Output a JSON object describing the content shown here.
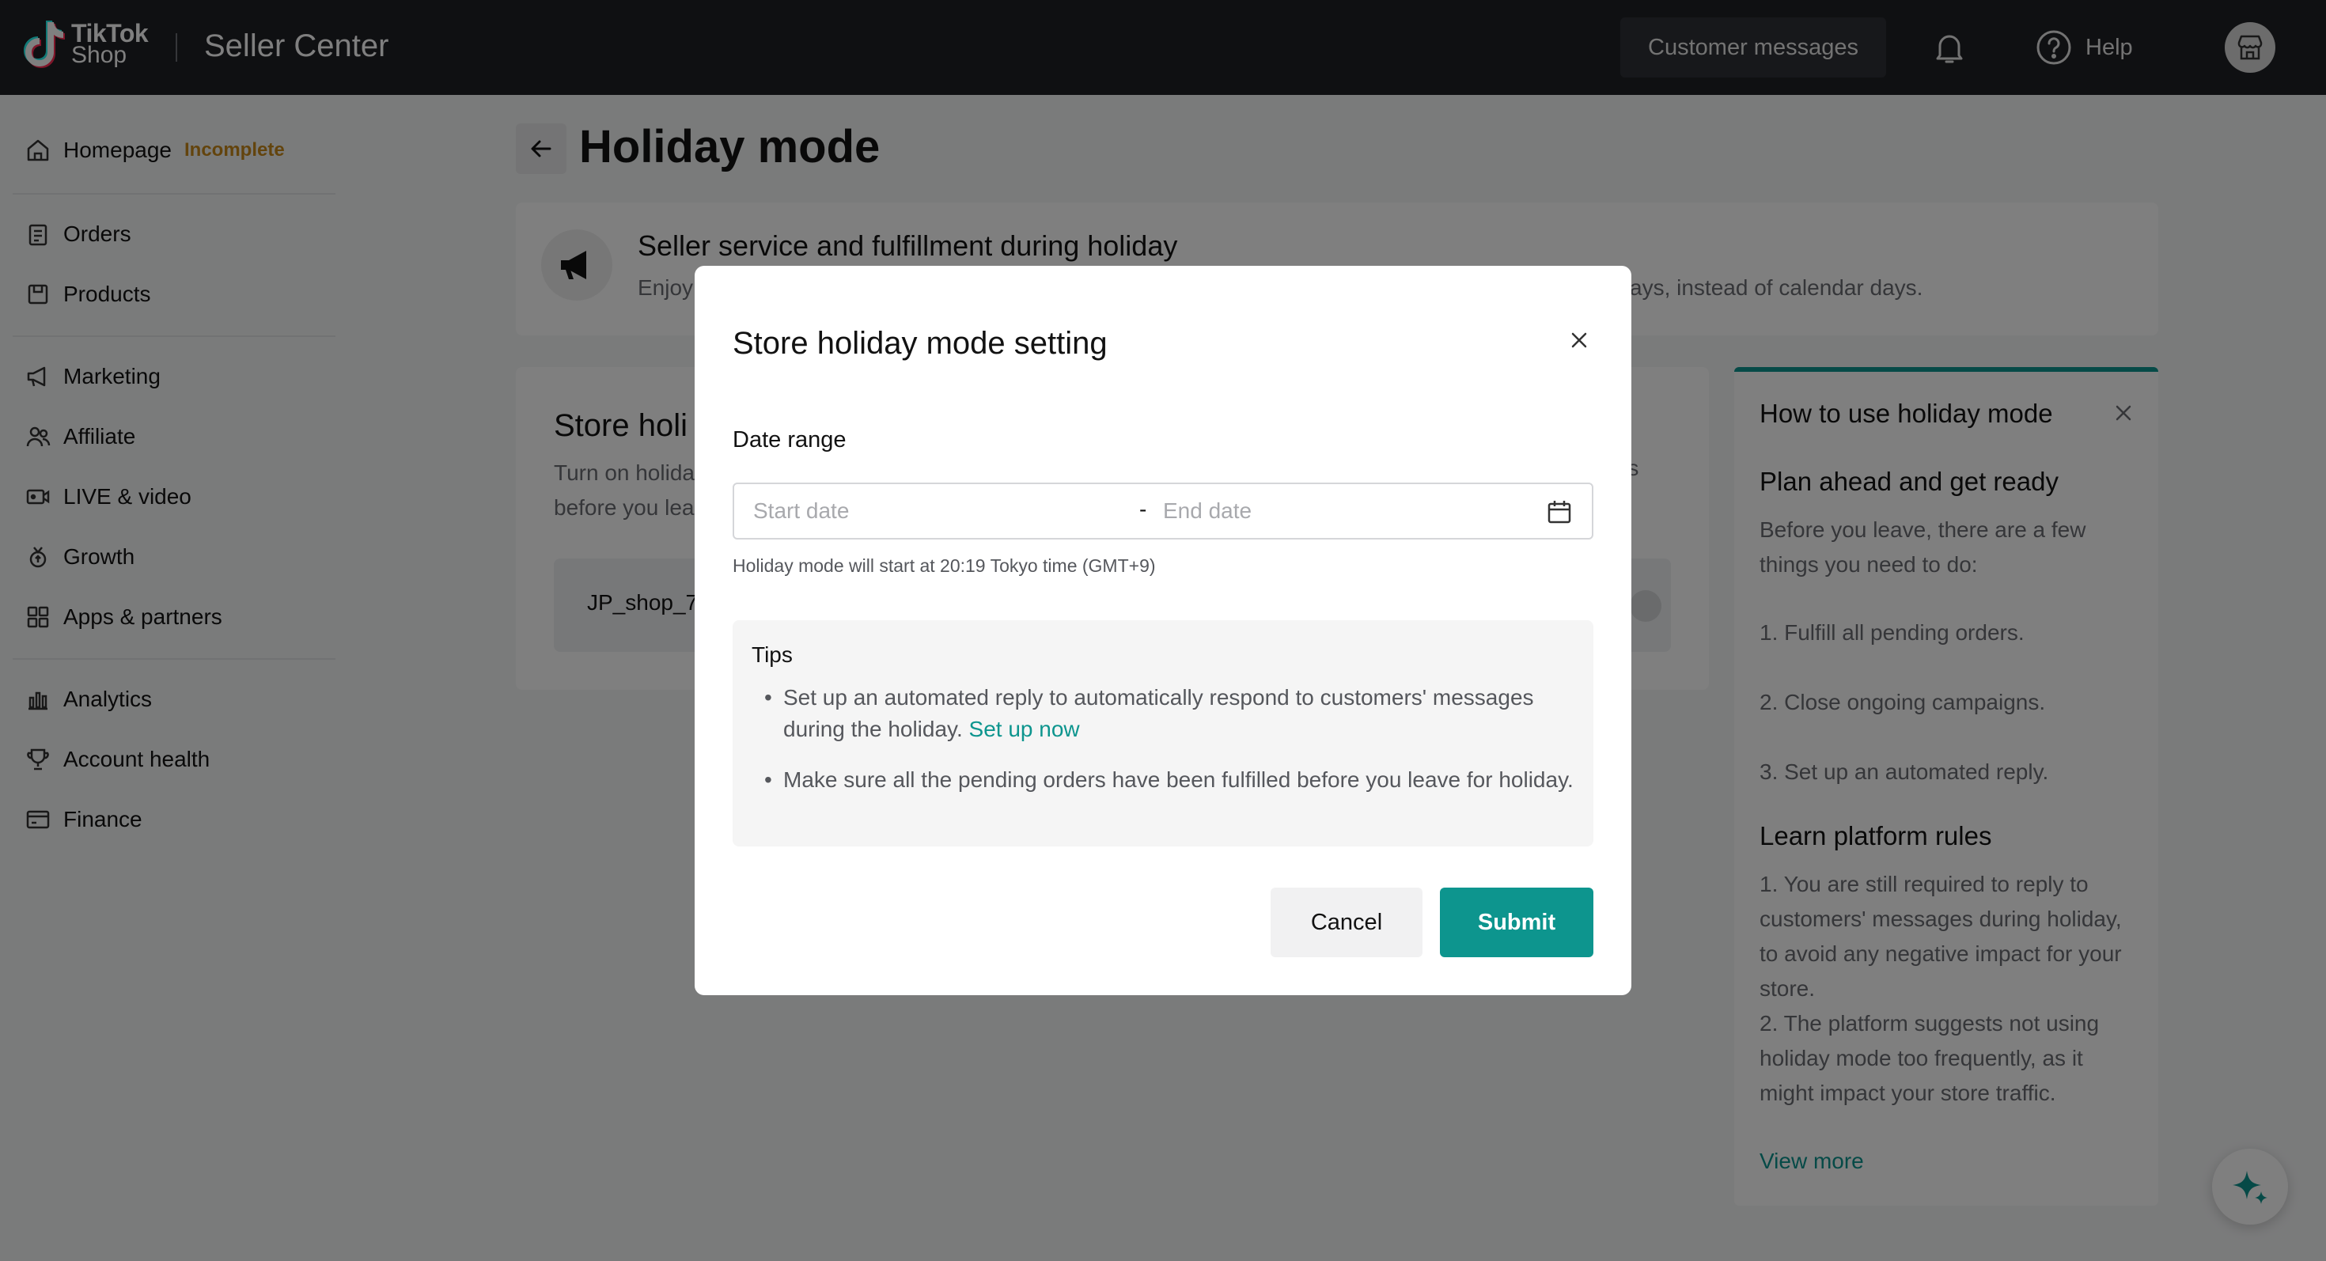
{
  "header": {
    "logo_line1": "TikTok",
    "logo_line2": "Shop",
    "product_title": "Seller Center",
    "customer_messages": "Customer messages",
    "help": "Help"
  },
  "sidebar": {
    "homepage": "Homepage",
    "homepage_badge": "Incomplete",
    "items": [
      "Orders",
      "Products",
      "Marketing",
      "Affiliate",
      "LIVE & video",
      "Growth",
      "Apps & partners",
      "Analytics",
      "Account health",
      "Finance"
    ]
  },
  "page": {
    "title": "Holiday mode",
    "banner_title": "Seller service and fulfillment during holiday",
    "banner_desc_start": "Enjoy",
    "banner_desc_end": "ays, instead of calendar days.",
    "store_title": "Store holi",
    "store_desc_line1": "Turn on holida",
    "store_desc_line2": "before you lea",
    "store_desc_tail": "rs",
    "shop_name": "JP_shop_74"
  },
  "help_panel": {
    "title": "How to use holiday mode",
    "section1_title": "Plan ahead and get ready",
    "section1_text": "Before you leave, there are a few things you need to do:",
    "steps": [
      "1. Fulfill all pending orders.",
      "2. Close ongoing campaigns.",
      "3. Set up an automated reply."
    ],
    "section2_title": "Learn platform rules",
    "rule1": "1. You are still required to reply to customers' messages during holiday, to avoid any negative impact for your store.",
    "rule2": "2. The platform suggests not using holiday mode too frequently, as it might impact your store traffic.",
    "view_more": "View more"
  },
  "modal": {
    "title": "Store holiday mode setting",
    "date_range_label": "Date range",
    "start_placeholder": "Start date",
    "date_separator": "-",
    "end_placeholder": "End date",
    "hint": "Holiday mode will start at 20:19 Tokyo time (GMT+9)",
    "tips_title": "Tips",
    "tip1": "Set up an automated reply to automatically respond to customers' messages during the holiday.",
    "tip1_link": "Set up now",
    "tip2": "Make sure all the pending orders have been fulfilled before you leave for holiday.",
    "cancel": "Cancel",
    "submit": "Submit"
  },
  "colors": {
    "accent": "#0d958e",
    "topbar": "#1f2024",
    "badge": "#c7891b"
  },
  "icons": [
    "tiktok-logo-icon",
    "bell-icon",
    "help-icon",
    "store-icon",
    "home-icon",
    "orders-icon",
    "products-icon",
    "marketing-icon",
    "affiliate-icon",
    "live-video-icon",
    "growth-icon",
    "apps-icon",
    "analytics-icon",
    "account-health-icon",
    "finance-icon",
    "back-arrow-icon",
    "megaphone-icon",
    "close-icon",
    "calendar-icon",
    "sparkle-icon"
  ]
}
